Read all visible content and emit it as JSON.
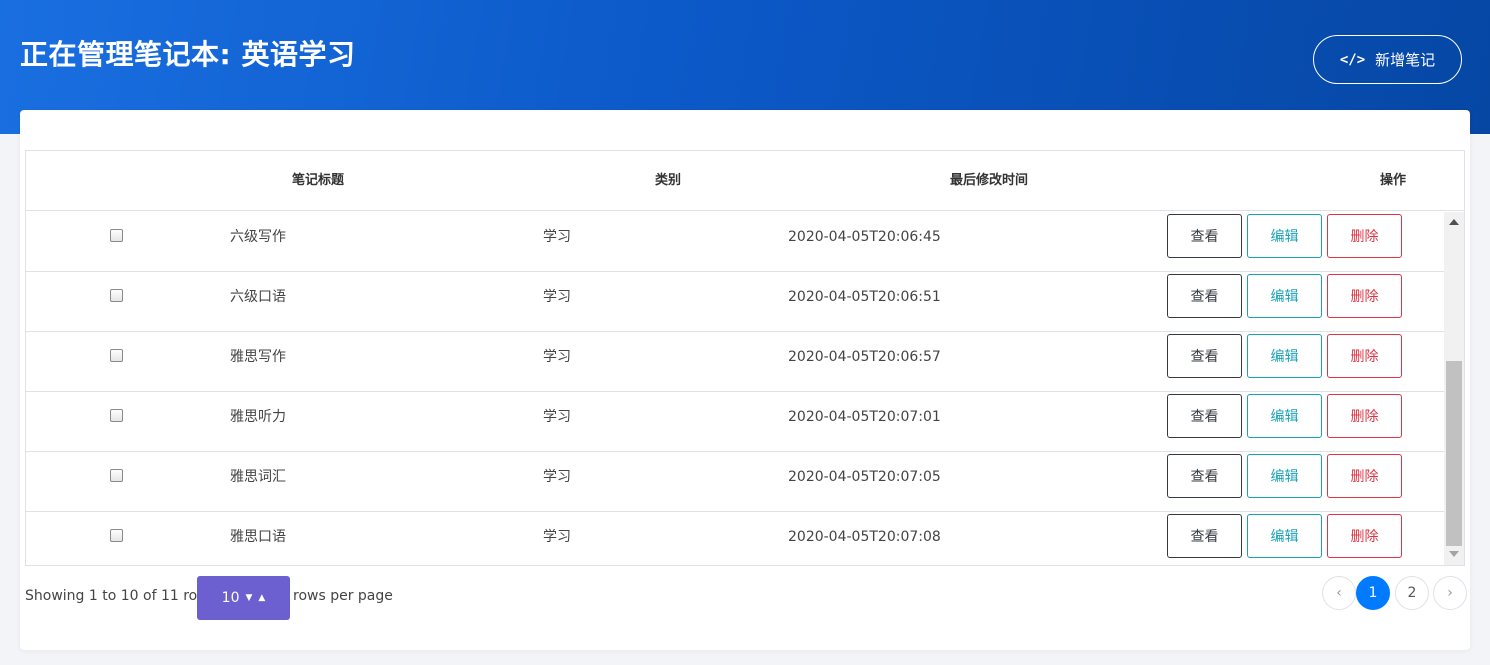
{
  "header": {
    "title": "正在管理笔记本: 英语学习",
    "new_note_label": "新增笔记",
    "new_note_icon": "</>"
  },
  "table": {
    "columns": [
      "",
      "笔记标题",
      "类别",
      "最后修改时间",
      "操作"
    ],
    "rows": [
      {
        "title": "六级写作",
        "category": "学习",
        "modified": "2020-04-05T20:06:45"
      },
      {
        "title": "六级口语",
        "category": "学习",
        "modified": "2020-04-05T20:06:51"
      },
      {
        "title": "雅思写作",
        "category": "学习",
        "modified": "2020-04-05T20:06:57"
      },
      {
        "title": "雅思听力",
        "category": "学习",
        "modified": "2020-04-05T20:07:01"
      },
      {
        "title": "雅思词汇",
        "category": "学习",
        "modified": "2020-04-05T20:07:05"
      },
      {
        "title": "雅思口语",
        "category": "学习",
        "modified": "2020-04-05T20:07:08"
      }
    ],
    "actions": {
      "view": "查看",
      "edit": "编辑",
      "delete": "删除"
    }
  },
  "footer": {
    "showing": "Showing 1 to 10 of 11 rows",
    "page_size": "10",
    "per_page": "rows per page"
  },
  "pagination": {
    "prev": "‹",
    "pages": [
      "1",
      "2"
    ],
    "current": "1",
    "next": "›"
  },
  "colors": {
    "banner": "#0c59c9",
    "view": "#343a40",
    "edit": "#17a2b8",
    "delete": "#dc3545",
    "page_size_bg": "#6c5fcf",
    "active_page": "#007bff"
  }
}
